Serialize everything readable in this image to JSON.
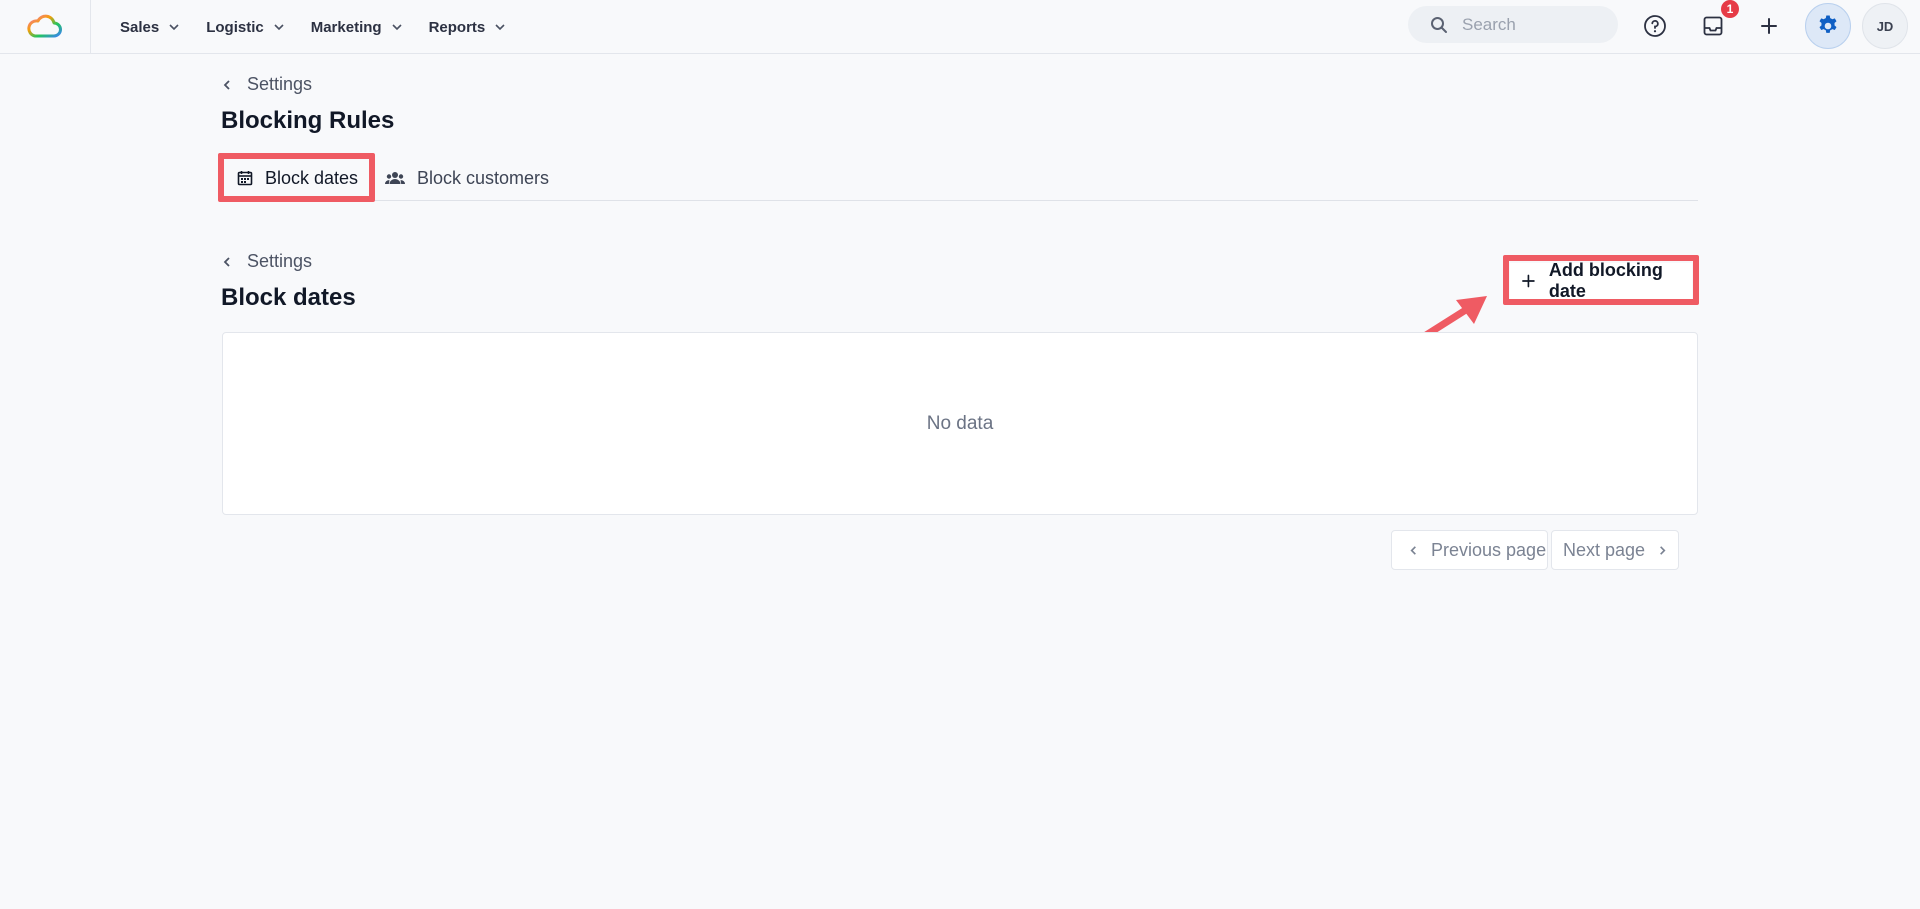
{
  "nav": {
    "items": [
      {
        "label": "Sales"
      },
      {
        "label": "Logistic"
      },
      {
        "label": "Marketing"
      },
      {
        "label": "Reports"
      }
    ]
  },
  "topbar": {
    "search_placeholder": "Search",
    "notification_count": "1",
    "avatar_initials": "JD"
  },
  "page": {
    "breadcrumb": "Settings",
    "title": "Blocking Rules",
    "tabs": [
      {
        "label": "Block dates",
        "icon": "calendar-icon",
        "active": true
      },
      {
        "label": "Block customers",
        "icon": "users-icon",
        "active": false
      }
    ]
  },
  "section": {
    "breadcrumb": "Settings",
    "title": "Block dates",
    "add_button_label": "Add blocking date",
    "empty_text": "No data",
    "prev_label": "Previous page",
    "next_label": "Next page"
  },
  "colors": {
    "accent": "#0f6ad8",
    "highlight": "#ef5b63",
    "badge": "#e63b47"
  }
}
